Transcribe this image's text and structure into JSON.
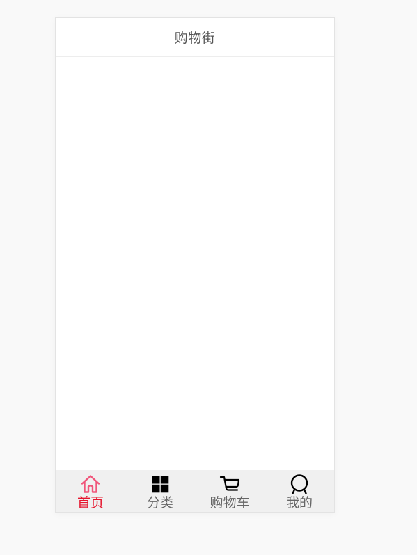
{
  "header": {
    "title": "购物街"
  },
  "tabbar": {
    "tabs": [
      {
        "label": "首页",
        "icon": "home-icon",
        "active": true
      },
      {
        "label": "分类",
        "icon": "category-grid-icon",
        "active": false
      },
      {
        "label": "购物车",
        "icon": "shopping-cart-icon",
        "active": false
      },
      {
        "label": "我的",
        "icon": "profile-icon",
        "active": false
      }
    ]
  },
  "colors": {
    "page_background": "#f9f9f9",
    "active_tab_text": "#e5142d",
    "active_tab_icon": "#f0557a",
    "inactive_tab_text": "#666666",
    "inactive_tab_icon": "#000000",
    "tabbar_background": "#f0f0f0"
  }
}
